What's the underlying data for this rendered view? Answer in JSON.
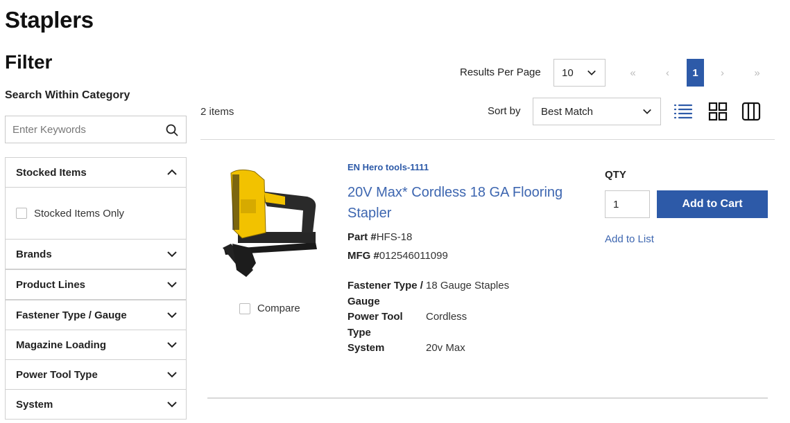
{
  "page": {
    "title": "Staplers"
  },
  "filter": {
    "title": "Filter",
    "search_label": "Search Within Category",
    "search_placeholder": "Enter Keywords",
    "facets": [
      {
        "label": "Stocked Items",
        "expanded": true,
        "options": [
          {
            "label": "Stocked Items Only",
            "checked": false
          }
        ]
      },
      {
        "label": "Brands",
        "expanded": false
      },
      {
        "label": "Product Lines",
        "expanded": false
      },
      {
        "label": "Fastener Type / Gauge",
        "expanded": false
      },
      {
        "label": "Magazine Loading",
        "expanded": false
      },
      {
        "label": "Power Tool Type",
        "expanded": false
      },
      {
        "label": "System",
        "expanded": false
      }
    ]
  },
  "toolbar": {
    "results_per_page_label": "Results Per Page",
    "results_per_page_value": "10",
    "pagination": {
      "first": "«",
      "prev": "‹",
      "current": "1",
      "next": "›",
      "last": "»"
    },
    "items_count": "2 items",
    "sort_label": "Sort by",
    "sort_value": "Best Match",
    "views": [
      "list-view-icon",
      "grid-view-icon",
      "table-view-icon"
    ],
    "active_view": "list"
  },
  "product": {
    "brand": "EN Hero tools-1111",
    "title": "20V Max* Cordless 18 GA Flooring Stapler",
    "part_label": "Part #",
    "part_value": "HFS-18",
    "mfg_label": "MFG #",
    "mfg_value": "012546011099",
    "attributes": [
      {
        "name": "Fastener Type / Gauge",
        "value": "18 Gauge Staples"
      },
      {
        "name": "Power Tool Type",
        "value": "Cordless"
      },
      {
        "name": "System",
        "value": "20v Max"
      }
    ],
    "compare_label": "Compare",
    "qty_label": "QTY",
    "qty_value": "1",
    "add_to_cart": "Add to Cart",
    "add_to_list": "Add to List"
  },
  "colors": {
    "primary": "#2d5aa8",
    "link": "#3d66b0",
    "border": "#d0d0d0",
    "tool_yellow": "#f2c200"
  }
}
